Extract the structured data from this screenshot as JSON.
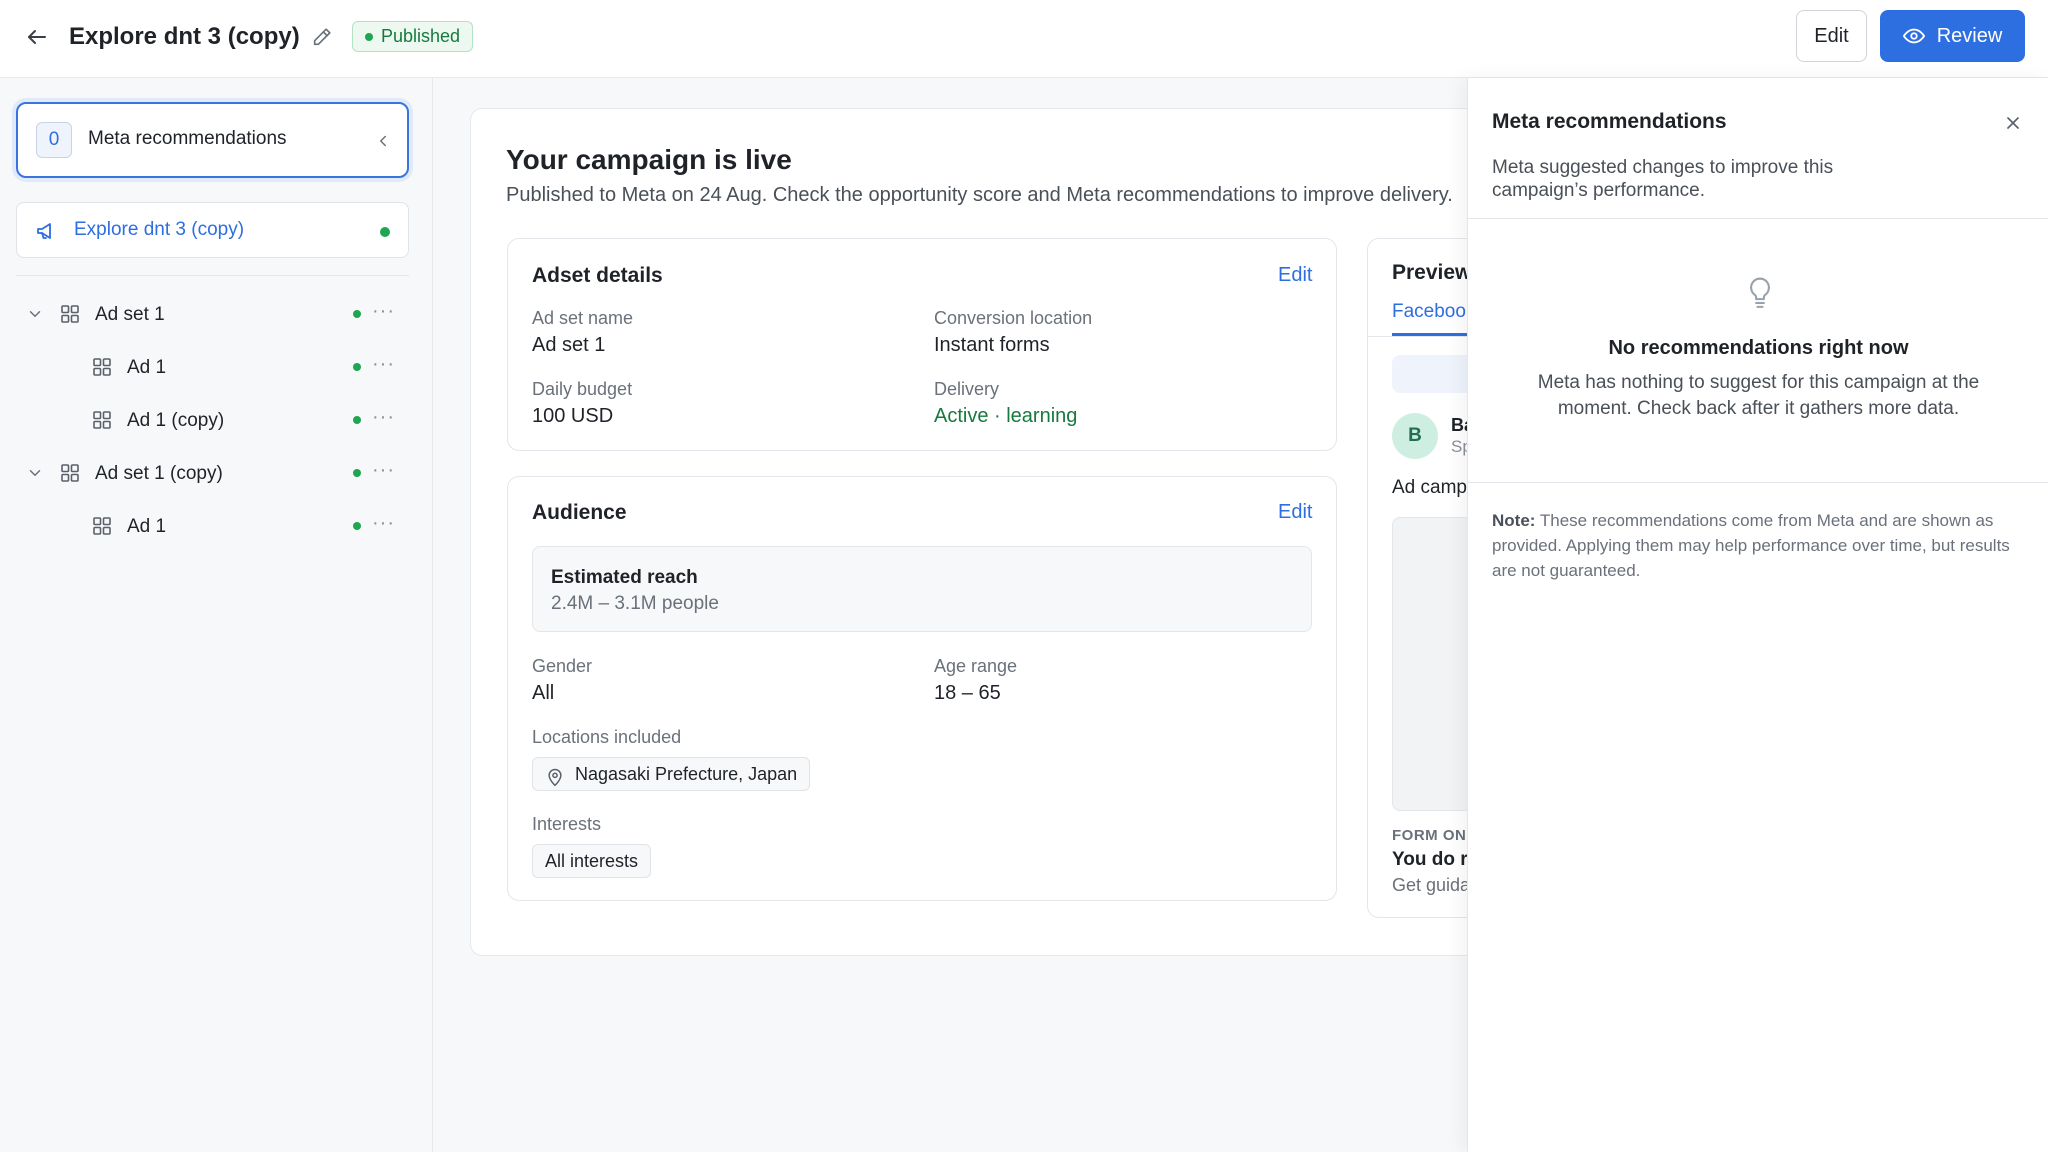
{
  "header": {
    "title": "Explore dnt 3 (copy)",
    "status": "Published",
    "edit_label": "Edit",
    "review_label": "Review"
  },
  "sidebar": {
    "recommendations": {
      "count": "0",
      "label": "Meta recommendations"
    },
    "campaign": {
      "label": "Explore dnt 3 (copy)"
    },
    "tree": [
      {
        "label": "Ad set 1",
        "type": "adset"
      },
      {
        "label": "Ad 1",
        "type": "ad"
      },
      {
        "label": "Ad 1 (copy)",
        "type": "ad"
      },
      {
        "label": "Ad set 1 (copy)",
        "type": "adset"
      },
      {
        "label": "Ad 1",
        "type": "ad"
      }
    ],
    "more_glyph": "···"
  },
  "main": {
    "title": "Your campaign is live",
    "subtitle": "Published to Meta on 24 Aug. Check the opportunity score and Meta recommendations to improve delivery.",
    "adset": {
      "title": "Adset details",
      "edit": "Edit",
      "ad_set_name_label": "Ad set name",
      "ad_set_name": "Ad set 1",
      "conversion_location_label": "Conversion location",
      "conversion_location": "Instant forms",
      "daily_budget_label": "Daily budget",
      "daily_budget": "100 USD",
      "delivery_label": "Delivery",
      "delivery": "Active · learning"
    },
    "audience": {
      "title": "Audience",
      "edit": "Edit",
      "reach_title": "Estimated reach",
      "reach_value": "2.4M – 3.1M people",
      "gender_label": "Gender",
      "gender": "All",
      "age_label": "Age range",
      "age": "18 – 65",
      "locations_label": "Locations included",
      "location": "Nagasaki Prefecture, Japan",
      "interests_label": "Interests",
      "interest": "All interests"
    },
    "preview": {
      "title": "Preview",
      "tab": "Facebook",
      "avatar_letter": "B",
      "page_name": "Ba",
      "sponsored": "Sp",
      "text": "Ad camp",
      "form_label": "FORM ON",
      "form_title": "You do r",
      "form_sub": "Get guida"
    }
  },
  "side_panel": {
    "title": "Meta recommendations",
    "description": "Meta suggested changes to improve this campaign’s performance.",
    "empty_title": "No recommendations right now",
    "empty_sub": "Meta has nothing to suggest for this campaign at the moment. Check back after it gathers more data.",
    "note_label": "Note:",
    "note_text": " These recommendations come from Meta and are shown as provided. Applying them may help performance over time, but results are not guaranteed."
  },
  "colors": {
    "accent": "#2d6ee0",
    "success": "#1fa652",
    "success_text": "#167a3e"
  }
}
